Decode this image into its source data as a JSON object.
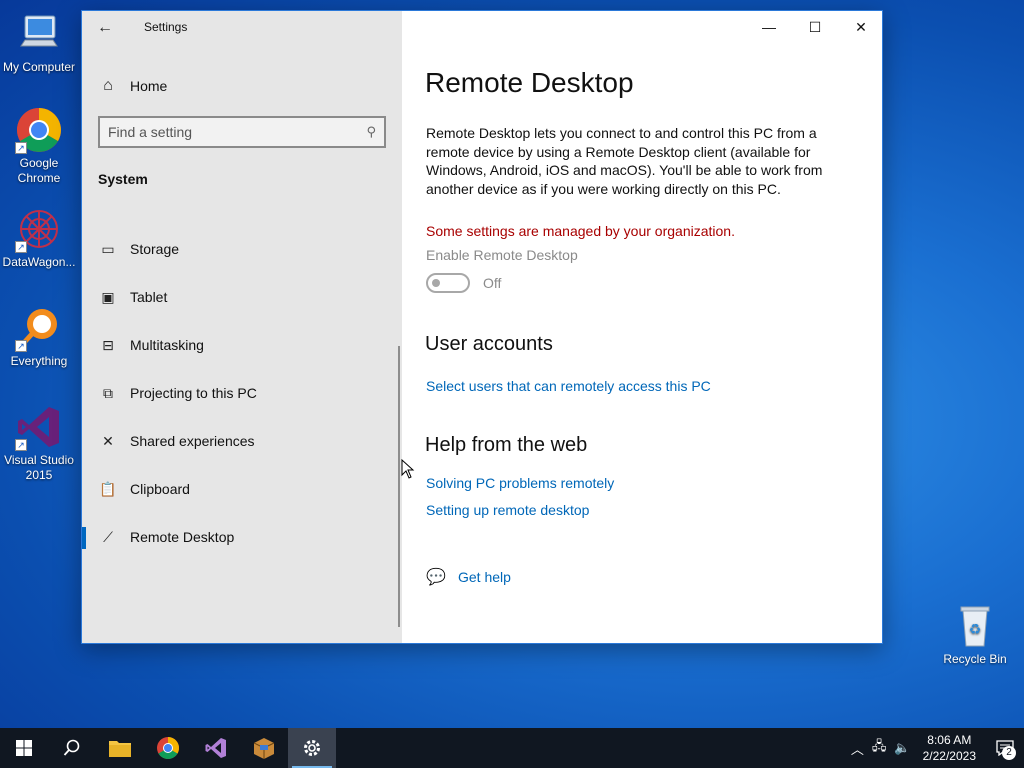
{
  "desktop": {
    "icons": [
      {
        "label": "My Computer"
      },
      {
        "label": "Google Chrome"
      },
      {
        "label": "DataWagon..."
      },
      {
        "label": "Everything"
      },
      {
        "label": "Visual Studio 2015"
      },
      {
        "label": "Recycle Bin"
      }
    ]
  },
  "window": {
    "app_title": "Settings",
    "controls": {
      "minimize": "—",
      "maximize": "☐",
      "close": "✕"
    }
  },
  "sidebar": {
    "home_label": "Home",
    "search_placeholder": "Find a setting",
    "section_title": "System",
    "items": [
      {
        "label": "Storage",
        "icon": "storage-icon",
        "active": false
      },
      {
        "label": "Tablet",
        "icon": "tablet-icon",
        "active": false
      },
      {
        "label": "Multitasking",
        "icon": "multitasking-icon",
        "active": false
      },
      {
        "label": "Projecting to this PC",
        "icon": "projecting-icon",
        "active": false
      },
      {
        "label": "Shared experiences",
        "icon": "shared-experiences-icon",
        "active": false
      },
      {
        "label": "Clipboard",
        "icon": "clipboard-icon",
        "active": false
      },
      {
        "label": "Remote Desktop",
        "icon": "remote-desktop-icon",
        "active": true
      }
    ]
  },
  "content": {
    "title": "Remote Desktop",
    "description": "Remote Desktop lets you connect to and control this PC from a remote device by using a Remote Desktop client (available for Windows, Android, iOS and macOS). You'll be able to work from another device as if you were working directly on this PC.",
    "managed_warning": "Some settings are managed by your organization.",
    "enable_label": "Enable Remote Desktop",
    "toggle_state": "Off",
    "user_accounts_heading": "User accounts",
    "select_users_link": "Select users that can remotely access this PC",
    "help_heading": "Help from the web",
    "help_links": [
      "Solving PC problems remotely",
      "Setting up remote desktop"
    ],
    "get_help": "Get help"
  },
  "taskbar": {
    "time": "8:06 AM",
    "date": "2/22/2023",
    "notification_count": "2"
  },
  "colors": {
    "accent": "#0067c0",
    "link": "#0067b8",
    "warning": "#a80000",
    "sidebar_bg": "#e6e6e6",
    "taskbar_bg": "#101721"
  }
}
